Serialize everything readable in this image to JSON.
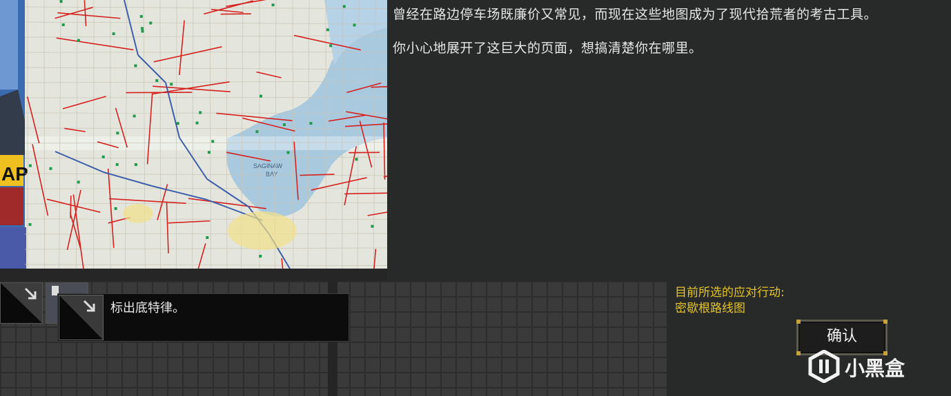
{
  "story": {
    "line1": "曾经在路边停车场既廉价又常见，而现在这些地图成为了现代拾荒者的考古工具。",
    "line2": "你小心地展开了这巨大的页面，想搞清楚你在哪里。"
  },
  "map": {
    "bay_label_line1": "SAGINAW",
    "bay_label_line2": "BAY",
    "cover_text": "AP"
  },
  "tooltip": {
    "text": "标出底特律。"
  },
  "selection": {
    "label": "目前所选的应对行动:",
    "value": "密歇根路线图"
  },
  "confirm_label": "确认",
  "watermark": {
    "text": "小黑盒"
  },
  "colors": {
    "road_red": "#d5201e",
    "water_blue": "#a9c9df",
    "highlight_yellow": "#e6c428",
    "panel_bg": "#282a29"
  }
}
